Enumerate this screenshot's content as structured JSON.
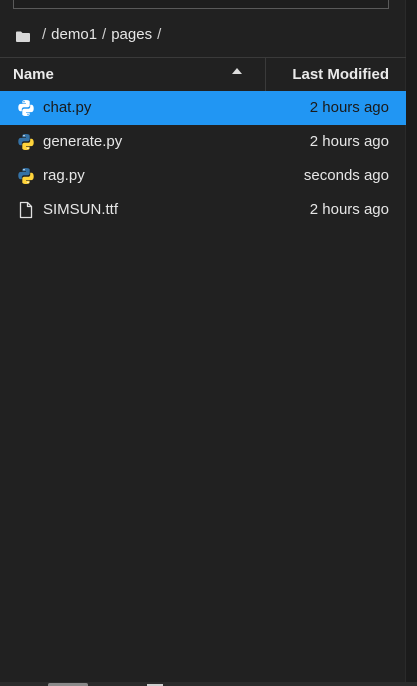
{
  "breadcrumb": {
    "icon": "folder-icon",
    "separator": "/",
    "parts": [
      "demo1",
      "pages"
    ]
  },
  "table": {
    "headers": {
      "name": "Name",
      "last_modified": "Last Modified",
      "sort_icon": "sort-ascending-icon"
    },
    "rows": [
      {
        "name": "chat.py",
        "modified": "2 hours ago",
        "icon": "python-file-icon",
        "selected": true
      },
      {
        "name": "generate.py",
        "modified": "2 hours ago",
        "icon": "python-file-icon",
        "selected": false
      },
      {
        "name": "rag.py",
        "modified": "seconds ago",
        "icon": "python-file-icon",
        "selected": false
      },
      {
        "name": "SIMSUN.ttf",
        "modified": "2 hours ago",
        "icon": "generic-file-icon",
        "selected": false
      }
    ]
  },
  "colors": {
    "background": "#212121",
    "selection": "#2196f3",
    "text": "#e6e6e6",
    "python_blue": "#3572a5",
    "python_yellow": "#ffd43b"
  }
}
